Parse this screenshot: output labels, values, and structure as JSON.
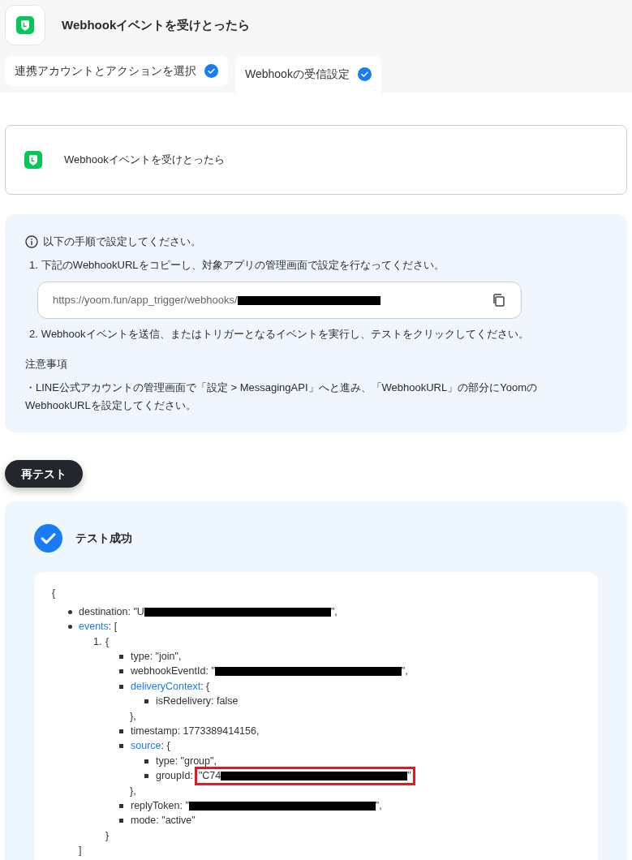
{
  "header": {
    "title": "Webhookイベントを受けとったら"
  },
  "tabs": [
    {
      "label": "連携アカウントとアクションを選択",
      "selected": false,
      "done": true
    },
    {
      "label": "Webhookの受信設定",
      "selected": true,
      "done": true
    }
  ],
  "trigger_card": {
    "title": "Webhookイベントを受けとったら"
  },
  "instructions": {
    "intro": "以下の手順で設定してください。",
    "steps": [
      {
        "marker": "1.",
        "text": "下記のWebhookURLをコピーし、対象アプリの管理画面で設定を行なってください。"
      },
      {
        "marker": "2.",
        "text": "Webhookイベントを送信、またはトリガーとなるイベントを実行し、テストをクリックしてください。"
      }
    ],
    "url_field": {
      "value": "https://yoom.fun/app_trigger/webhooks/",
      "redacted": true
    },
    "note_title": "注意事項",
    "note": "・LINE公式アカウントの管理画面で「設定 > MessagingAPI」へと進み、「WebhookURL」の部分にYoomのWebhookURLを設定してください。"
  },
  "retest_button": "再テスト",
  "result": {
    "title": "テスト成功",
    "success": true,
    "code": {
      "open": "{",
      "items": [
        {
          "kind": "disc",
          "key": "destination",
          "text": ": ",
          "value": "\"U",
          "redacted": true,
          "value_end": "\","
        },
        {
          "kind": "disc",
          "key": "events",
          "link": true,
          "text": ": [",
          "close": "]",
          "children": [
            {
              "kind": "numbered",
              "marker": "1.",
              "text": "{",
              "close": "}",
              "children": [
                {
                  "kind": "square",
                  "key": "type",
                  "text": ": \"join\","
                },
                {
                  "kind": "square",
                  "key": "webhookEventId",
                  "text": ": ",
                  "value": "\"",
                  "redacted": true,
                  "value_end": "\","
                },
                {
                  "kind": "square",
                  "key": "deliveryContext",
                  "link": true,
                  "text": ": {",
                  "close": "},",
                  "children": [
                    {
                      "kind": "square",
                      "key": "isRedelivery",
                      "text": ": false"
                    }
                  ]
                },
                {
                  "kind": "square",
                  "key": "timestamp",
                  "text": ": 1773389414156,"
                },
                {
                  "kind": "square",
                  "key": "source",
                  "link": true,
                  "text": ": {",
                  "close": "},",
                  "children": [
                    {
                      "kind": "square",
                      "key": "type",
                      "text": ": \"group\","
                    },
                    {
                      "kind": "square",
                      "key": "groupId",
                      "text": ":",
                      "value": "\"C74",
                      "redacted": true,
                      "value_end": "\"",
                      "highlighted": true
                    }
                  ]
                },
                {
                  "kind": "square",
                  "key": "replyToken",
                  "text": ": ",
                  "value": "\"",
                  "redacted": true,
                  "value_end": "\","
                },
                {
                  "kind": "square",
                  "key": "mode",
                  "text": ": \"active\""
                }
              ]
            }
          ]
        }
      ]
    }
  }
}
